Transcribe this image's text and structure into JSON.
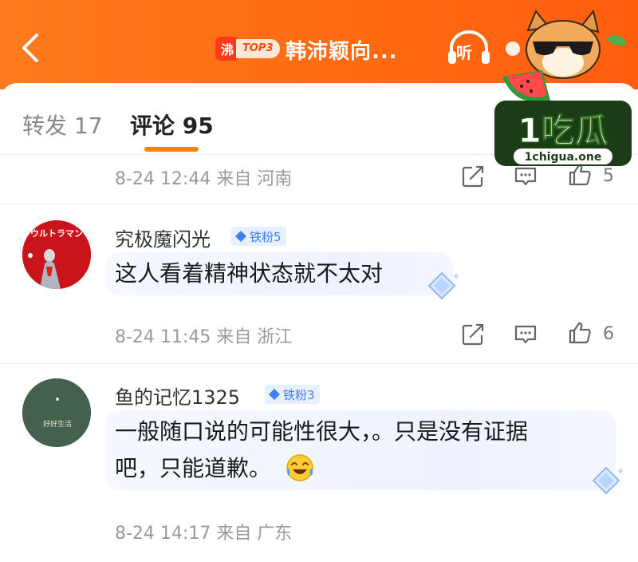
{
  "header": {
    "back_icon": "chevron-left-icon",
    "hot_char": "沸",
    "hot_rank": "TOP3",
    "title": "韩沛颖向...",
    "listen_label": "听"
  },
  "tabs": [
    {
      "label": "转发 17"
    },
    {
      "label": "评论 95"
    }
  ],
  "first_meta": {
    "time_location": "8-24 12:44  来自 河南",
    "like_count": "5"
  },
  "comments": [
    {
      "username": "究极魔闪光",
      "badge": "铁粉5",
      "text_lines": [
        "这人看着精神状态就不太对"
      ],
      "meta": "8-24 11:45  来自 浙江",
      "like_count": "6",
      "avatar_text": "ウルトラマン"
    },
    {
      "username": "鱼的记忆1325",
      "badge": "铁粉3",
      "text_lines": [
        "一般随口说的可能性很大，。只是没有证据",
        "吧，只能道歉。"
      ],
      "meta": "8-24 14:17  来自 广东",
      "avatar_text": "好好生活"
    }
  ],
  "watermark": {
    "brand": "1吃瓜",
    "site": "1chigua.one"
  },
  "colors": {
    "accent": "#ff8200",
    "header": "#ff6a12",
    "badge_blue": "#3d7ff5"
  }
}
